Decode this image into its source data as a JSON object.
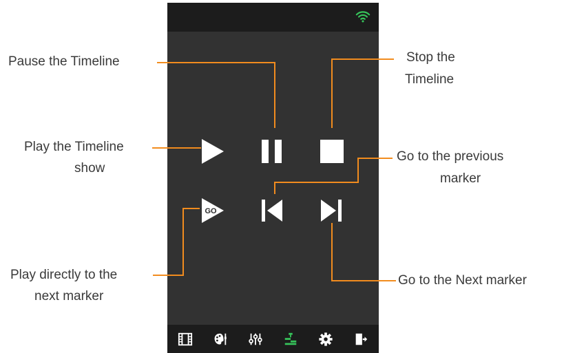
{
  "colors": {
    "accent": "#f28c1e",
    "wifi": "#36c35a",
    "active_tab": "#36c35a",
    "icon": "#ffffff",
    "panel": "#323232",
    "bar": "#1c1c1c"
  },
  "status_bar": {
    "wifi_icon": "wifi-icon"
  },
  "transport": {
    "play": {
      "icon": "play-icon"
    },
    "pause": {
      "icon": "pause-icon"
    },
    "stop": {
      "icon": "stop-icon"
    },
    "go": {
      "icon": "go-to-marker-icon",
      "text": "GO"
    },
    "previous": {
      "icon": "previous-marker-icon"
    },
    "next": {
      "icon": "next-marker-icon"
    }
  },
  "tab_bar": [
    {
      "icon": "film-icon",
      "active": false
    },
    {
      "icon": "palette-icon",
      "active": false
    },
    {
      "icon": "sliders-icon",
      "active": false
    },
    {
      "icon": "timeline-icon",
      "active": true
    },
    {
      "icon": "gear-icon",
      "active": false
    },
    {
      "icon": "exit-icon",
      "active": false
    }
  ],
  "callouts": {
    "pause": "Pause the Timeline",
    "stop_line1": "Stop the",
    "stop_line2": "Timeline",
    "play_line1": "Play the Timeline",
    "play_line2": "show",
    "previous_line1": "Go to the previous",
    "previous_line2": "marker",
    "go_line1": "Play directly to the",
    "go_line2": "next marker",
    "next": "Go to the Next marker"
  }
}
